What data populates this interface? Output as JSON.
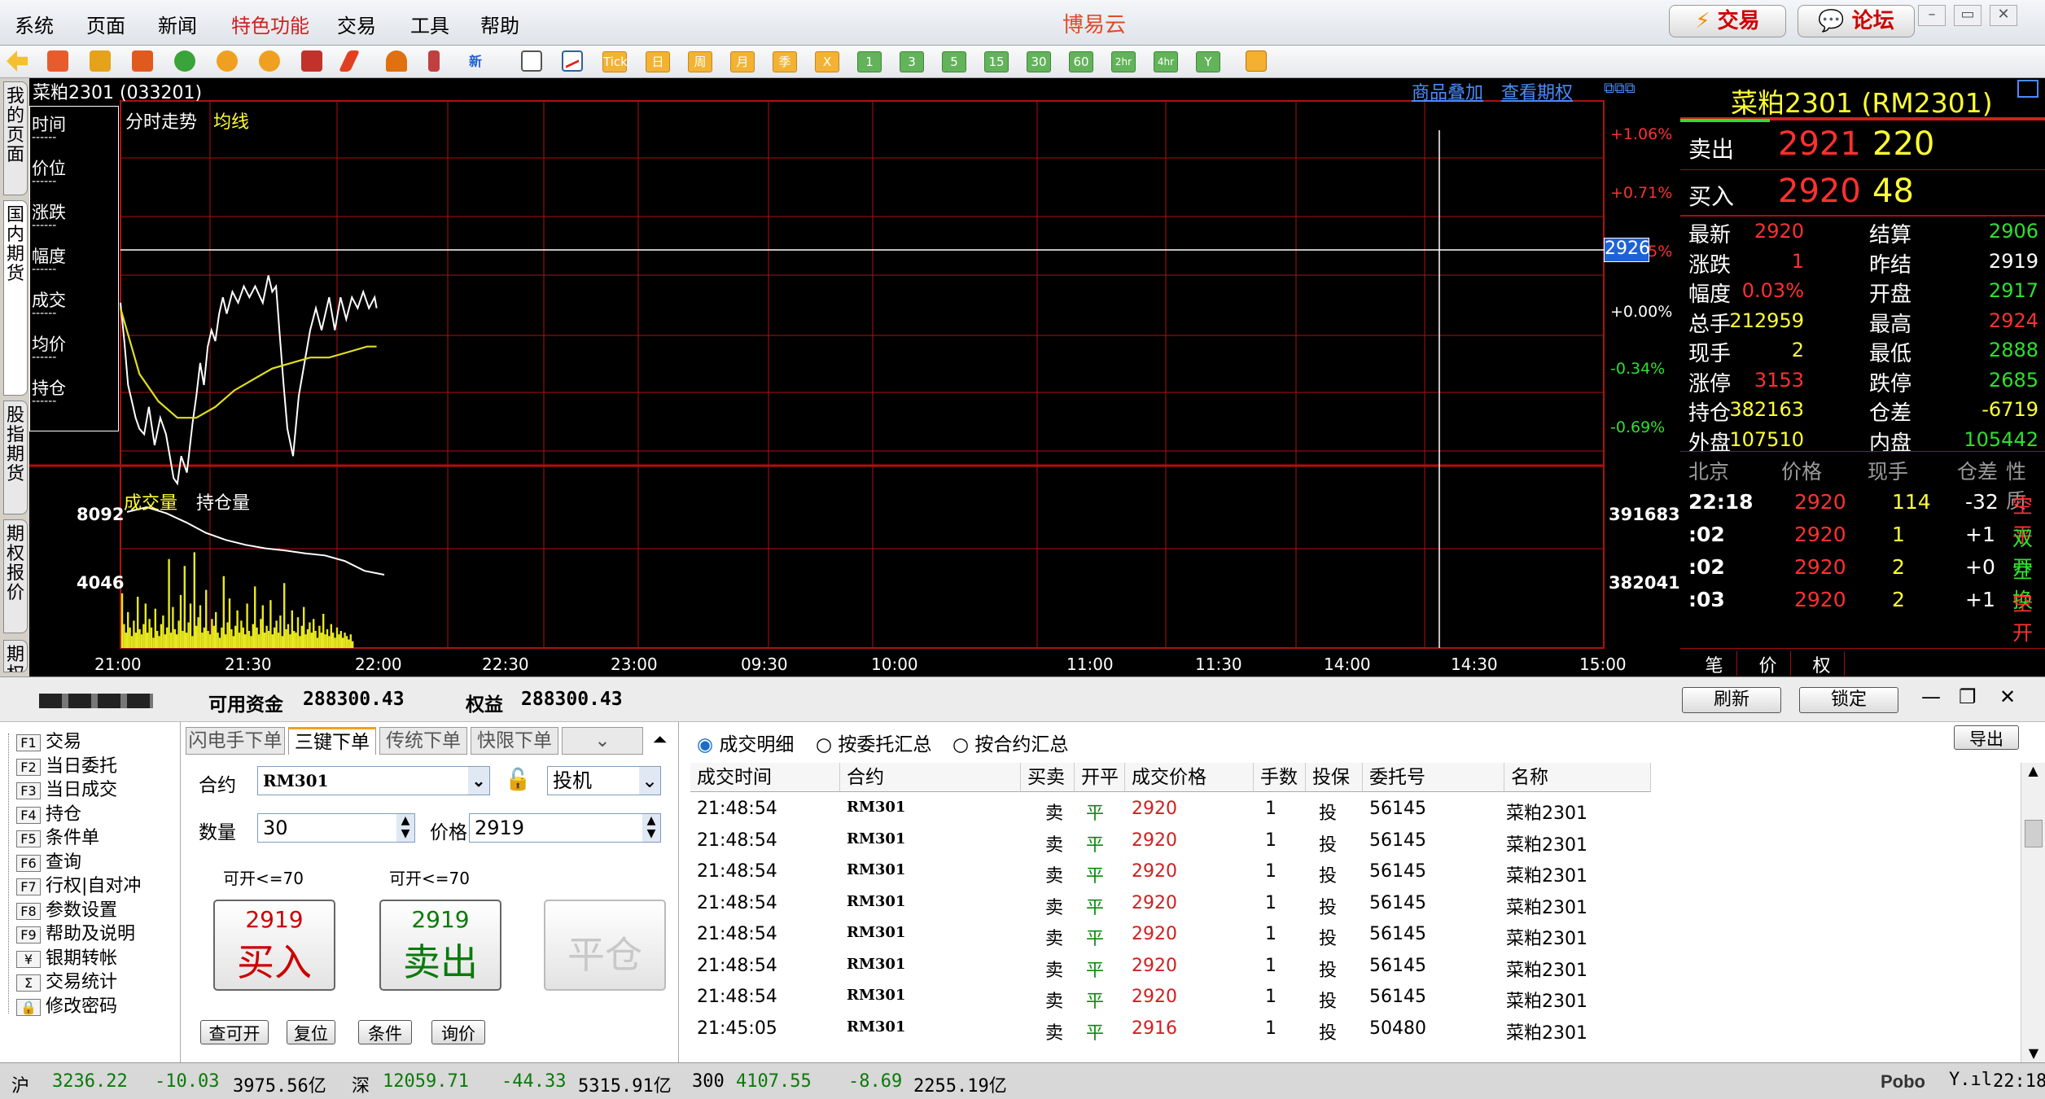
{
  "menu": {
    "items": [
      "系统",
      "页面",
      "新闻",
      "特色功能",
      "交易",
      "工具",
      "帮助"
    ],
    "app_title": "博易云",
    "trade_btn": "交易",
    "forum_btn": "论坛"
  },
  "toolbar": {
    "green": [
      "1",
      "3",
      "5",
      "15",
      "30",
      "60",
      "2hr",
      "4hr",
      "Y"
    ],
    "orange": [
      "Tick",
      "日",
      "周",
      "月",
      "季",
      "X"
    ]
  },
  "sidetabs": [
    "我的页面",
    "国内期货",
    "股指期货",
    "期权报价",
    "期权策略"
  ],
  "chart": {
    "symbol_line": "菜粕2301 (033201)",
    "links": [
      "商品叠加",
      "查看期权"
    ],
    "legend_main": [
      "分时走势",
      "均线"
    ],
    "legend_vol": [
      "成交量",
      "持仓量"
    ],
    "crosshair_price": "2926",
    "pct_labels": [
      "+1.06%",
      "+0.71%",
      "+0.35%",
      "+0.00%",
      "-0.34%",
      "-0.69%"
    ],
    "vol_left": [
      "8092",
      "4046"
    ],
    "vol_right": [
      "391683",
      "382041"
    ],
    "time_labels": [
      "21:00",
      "21:30",
      "22:00",
      "22:30",
      "23:00",
      "09:30",
      "10:00",
      "11:00",
      "11:30",
      "14:00",
      "14:30",
      "15:00"
    ],
    "info_box": {
      "labels": [
        "时间",
        "价位",
        "涨跌",
        "幅度",
        "成交",
        "均价",
        "持仓"
      ],
      "values": [
        "------",
        "------",
        "------",
        "------",
        "------",
        "------",
        "------"
      ]
    }
  },
  "chart_data": {
    "type": "line",
    "title": "分时走势",
    "x_unit": "minutes since 21:00",
    "series": [
      {
        "name": "分时走势",
        "x": [
          0,
          4,
          8,
          12,
          16,
          20,
          25,
          30,
          36,
          42,
          48,
          52,
          56,
          60,
          64,
          70,
          76,
          80,
          84,
          88,
          92,
          96,
          100,
          104,
          108,
          112,
          118,
          124,
          130,
          136,
          142,
          150,
          156,
          160,
          164,
          168,
          172,
          176,
          182,
          188,
          194,
          200,
          206,
          212,
          220,
          226,
          232,
          238,
          244,
          250,
          256,
          262,
          268,
          270
        ],
        "y": [
          2921,
          2914,
          2906,
          2903,
          2900,
          2898,
          2897,
          2902,
          2895,
          2900,
          2897,
          2893,
          2889,
          2888,
          2893,
          2890,
          2899,
          2904,
          2910,
          2906,
          2913,
          2916,
          2914,
          2919,
          2922,
          2919,
          2923,
          2921,
          2924,
          2922,
          2924,
          2921,
          2926,
          2923,
          2924,
          2915,
          2906,
          2898,
          2893,
          2904,
          2910,
          2916,
          2920,
          2916,
          2922,
          2916,
          2922,
          2918,
          2922,
          2920,
          2923,
          2920,
          2922,
          2920
        ]
      },
      {
        "name": "均线",
        "x": [
          0,
          20,
          40,
          60,
          80,
          100,
          120,
          140,
          160,
          180,
          200,
          220,
          240,
          260,
          270
        ],
        "y": [
          2920,
          2908,
          2903,
          2900,
          2900,
          2902,
          2905,
          2907,
          2909,
          2910,
          2911,
          2911,
          2912,
          2913,
          2913
        ]
      }
    ],
    "bars": {
      "name": "成交量",
      "max": 8092
    },
    "oi": {
      "name": "持仓量",
      "values": [
        391000,
        391683,
        390800,
        389500,
        388000,
        387000,
        386300,
        385800,
        385500,
        385100,
        384800,
        384000,
        382600,
        382041
      ]
    },
    "ylim": [
      2888,
      2951
    ]
  },
  "quote": {
    "title": "菜粕2301 (RM2301)",
    "ask_label": "卖出",
    "ask_price": "2921",
    "ask_vol": "220",
    "bid_label": "买入",
    "bid_price": "2920",
    "bid_vol": "48",
    "fields": [
      [
        "最新",
        "2920",
        "结算",
        "2906"
      ],
      [
        "涨跌",
        "1",
        "昨结",
        "2919"
      ],
      [
        "幅度",
        "0.03%",
        "开盘",
        "2917"
      ],
      [
        "总手",
        "212959",
        "最高",
        "2924"
      ],
      [
        "现手",
        "2",
        "最低",
        "2888"
      ],
      [
        "涨停",
        "3153",
        "跌停",
        "2685"
      ],
      [
        "持仓",
        "382163",
        "仓差",
        "-6719"
      ],
      [
        "外盘",
        "107510",
        "内盘",
        "105442"
      ]
    ],
    "tick_header": [
      "北京",
      "价格",
      "现手",
      "仓差",
      "性质"
    ],
    "ticks": [
      [
        "22:18",
        "2920",
        "114",
        "-32",
        "空平"
      ],
      [
        ":02",
        "2920",
        "1",
        "+1",
        "双开"
      ],
      [
        ":02",
        "2920",
        "2",
        "+0",
        "空换"
      ],
      [
        ":03",
        "2920",
        "2",
        "+1",
        "空开"
      ]
    ],
    "bottom_tabs": [
      "笔",
      "价",
      "权"
    ]
  },
  "account": {
    "funds_label": "可用资金",
    "funds": "288300.43",
    "equity_label": "权益",
    "equity": "288300.43",
    "refresh": "刷新",
    "lock": "锁定",
    "export": "导出"
  },
  "nav": [
    [
      "F1",
      "交易"
    ],
    [
      "F2",
      "当日委托"
    ],
    [
      "F3",
      "当日成交"
    ],
    [
      "F4",
      "持仓"
    ],
    [
      "F5",
      "条件单"
    ],
    [
      "F6",
      "查询"
    ],
    [
      "F7",
      "行权|自对冲"
    ],
    [
      "F8",
      "参数设置"
    ],
    [
      "F9",
      "帮助及说明"
    ],
    [
      "¥",
      "银期转帐"
    ],
    [
      "Σ",
      "交易统计"
    ],
    [
      "🔒",
      "修改密码"
    ]
  ],
  "order": {
    "tabs": [
      "闪电手下单",
      "三键下单",
      "传统下单",
      "快限下单"
    ],
    "contract_label": "合约",
    "contract": "RM301",
    "hedge": "投机",
    "qty_label": "数量",
    "qty": "30",
    "price_label": "价格",
    "price": "2919",
    "open_avail_1": "可开<=70",
    "open_avail_2": "可开<=70",
    "buy_price": "2919",
    "buy_label": "买入",
    "sell_price": "2919",
    "sell_label": "卖出",
    "close_label": "平仓",
    "bottom_btns": [
      "查可开",
      "复位",
      "条件",
      "询价"
    ]
  },
  "trades": {
    "radios": [
      "成交明细",
      "按委托汇总",
      "按合约汇总"
    ],
    "headers": [
      "成交时间",
      "合约",
      "买卖",
      "开平",
      "成交价格",
      "手数",
      "投保",
      "委托号",
      "名称"
    ],
    "rows": [
      [
        "21:48:54",
        "RM301",
        "卖",
        "平",
        "2920",
        "1",
        "投",
        "56145",
        "菜粕2301"
      ],
      [
        "21:48:54",
        "RM301",
        "卖",
        "平",
        "2920",
        "1",
        "投",
        "56145",
        "菜粕2301"
      ],
      [
        "21:48:54",
        "RM301",
        "卖",
        "平",
        "2920",
        "1",
        "投",
        "56145",
        "菜粕2301"
      ],
      [
        "21:48:54",
        "RM301",
        "卖",
        "平",
        "2920",
        "1",
        "投",
        "56145",
        "菜粕2301"
      ],
      [
        "21:48:54",
        "RM301",
        "卖",
        "平",
        "2920",
        "1",
        "投",
        "56145",
        "菜粕2301"
      ],
      [
        "21:48:54",
        "RM301",
        "卖",
        "平",
        "2920",
        "1",
        "投",
        "56145",
        "菜粕2301"
      ],
      [
        "21:48:54",
        "RM301",
        "卖",
        "平",
        "2920",
        "1",
        "投",
        "56145",
        "菜粕2301"
      ],
      [
        "21:45:05",
        "RM301",
        "卖",
        "平",
        "2916",
        "1",
        "投",
        "50480",
        "菜粕2301"
      ]
    ]
  },
  "status": {
    "sh_label": "沪",
    "sh_val": "3236.22",
    "sh_chg": "-10.03",
    "sh_amt": "3975.56亿",
    "sz_label": "深",
    "sz_val": "12059.71",
    "sz_chg": "-44.33",
    "sz_amt": "5315.91亿",
    "hs_label": "300",
    "hs_val": "4107.55",
    "hs_chg": "-8.69",
    "hs_amt": "2255.19亿",
    "brand": "Pobo",
    "clock": "22:18"
  },
  "colors": {
    "up": "#ff3030",
    "down": "#2ee02e",
    "grid": "#b01010",
    "avg": "#e0e020"
  }
}
